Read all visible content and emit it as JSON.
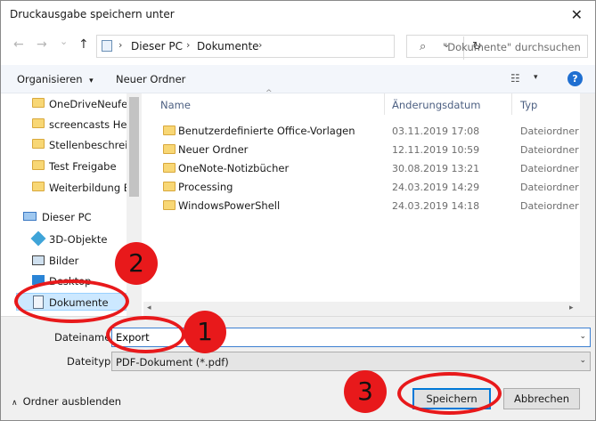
{
  "window": {
    "title": "Druckausgabe speichern unter",
    "close_glyph": "✕"
  },
  "nav": {
    "back_glyph": "←",
    "forward_glyph": "→",
    "dropdown_glyph": "⌄",
    "up_glyph": "↑",
    "breadcrumb": [
      "Dieser PC",
      "Dokumente"
    ],
    "breadcrumb_sep": "›",
    "address_dropdown_glyph": "⌄",
    "refresh_glyph": "↻",
    "search_icon": "search-icon",
    "search_glyph": "⌕",
    "search_placeholder": "\"Dokumente\" durchsuchen"
  },
  "toolbar": {
    "organize_label": "Organisieren",
    "organize_chevron": "▾",
    "new_folder_label": "Neuer Ordner",
    "view_glyph": "☷",
    "view_dd_glyph": "▾",
    "help_label": "?"
  },
  "sidebar": {
    "items": [
      {
        "label": "OneDriveNeufeld",
        "icon": "folder-icon"
      },
      {
        "label": "screencasts Hell",
        "icon": "folder-icon"
      },
      {
        "label": "Stellenbeschreib",
        "icon": "folder-icon"
      },
      {
        "label": "Test Freigabe",
        "icon": "folder-icon"
      },
      {
        "label": "Weiterbildung B",
        "icon": "folder-icon"
      },
      {
        "label": "Dieser PC",
        "icon": "computer-icon"
      },
      {
        "label": "3D-Objekte",
        "icon": "cube-icon"
      },
      {
        "label": "Bilder",
        "icon": "pictures-icon"
      },
      {
        "label": "Desktop",
        "icon": "desktop-icon"
      },
      {
        "label": "Dokumente",
        "icon": "document-icon",
        "selected": true
      }
    ]
  },
  "filelist": {
    "columns": [
      "Name",
      "Änderungsdatum",
      "Typ"
    ],
    "sort_glyph": "^",
    "rows": [
      {
        "name": "Benutzerdefinierte Office-Vorlagen",
        "date": "03.11.2019 17:08",
        "type": "Dateiordner"
      },
      {
        "name": "Neuer Ordner",
        "date": "12.11.2019 10:59",
        "type": "Dateiordner"
      },
      {
        "name": "OneNote-Notizbücher",
        "date": "30.08.2019 13:21",
        "type": "Dateiordner"
      },
      {
        "name": "Processing",
        "date": "24.03.2019 14:29",
        "type": "Dateiordner"
      },
      {
        "name": "WindowsPowerShell",
        "date": "24.03.2019 14:18",
        "type": "Dateiordner"
      }
    ],
    "hscroll_left_glyph": "◂",
    "hscroll_right_glyph": "▸"
  },
  "form": {
    "filename_label": "Dateiname:",
    "filename_value": "Export",
    "filetype_label": "Dateityp:",
    "filetype_value": "PDF-Dokument (*.pdf)",
    "combo_glyph": "⌄",
    "hide_folders_glyph": "∧",
    "hide_folders_label": "Ordner ausblenden",
    "save_label": "Speichern",
    "cancel_label": "Abbrechen"
  },
  "annotations": {
    "step_1": "1",
    "step_2": "2",
    "step_3": "3",
    "color": "#e8191b"
  }
}
